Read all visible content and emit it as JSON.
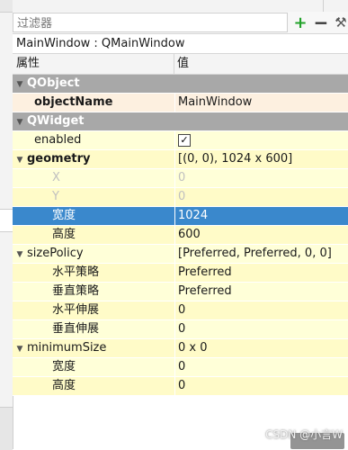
{
  "filter": {
    "placeholder": "过滤器"
  },
  "object_title": "MainWindow : QMainWindow",
  "header": {
    "property": "属性",
    "value": "值"
  },
  "rows": [
    {
      "kind": "cat",
      "name": "QObject",
      "value": ""
    },
    {
      "kind": "obj",
      "name": "objectName",
      "value": "MainWindow"
    },
    {
      "kind": "cat",
      "name": "QWidget",
      "value": ""
    },
    {
      "kind": "w",
      "name": "enabled",
      "value": "✓"
    },
    {
      "kind": "w2",
      "name": "geometry",
      "value": "[(0, 0), 1024 x 600]"
    },
    {
      "kind": "w",
      "name": "X",
      "value": "0"
    },
    {
      "kind": "w2",
      "name": "Y",
      "value": "0"
    },
    {
      "kind": "sel",
      "name": "宽度",
      "value": "1024"
    },
    {
      "kind": "w2",
      "name": "高度",
      "value": "600"
    },
    {
      "kind": "w",
      "name": "sizePolicy",
      "value": "[Preferred, Preferred, 0, 0]"
    },
    {
      "kind": "w2",
      "name": "水平策略",
      "value": "Preferred"
    },
    {
      "kind": "w",
      "name": "垂直策略",
      "value": "Preferred"
    },
    {
      "kind": "w2",
      "name": "水平伸展",
      "value": "0"
    },
    {
      "kind": "w",
      "name": "垂直伸展",
      "value": "0"
    },
    {
      "kind": "w2",
      "name": "minimumSize",
      "value": "0 x 0"
    },
    {
      "kind": "w",
      "name": "宽度",
      "value": "0"
    },
    {
      "kind": "w2",
      "name": "高度",
      "value": "0"
    }
  ],
  "watermark": "CSDN @小言W",
  "icons": {
    "add": "plus-icon",
    "remove": "minus-icon",
    "tool": "wrench-icon",
    "expand": "triangle-down-icon"
  }
}
